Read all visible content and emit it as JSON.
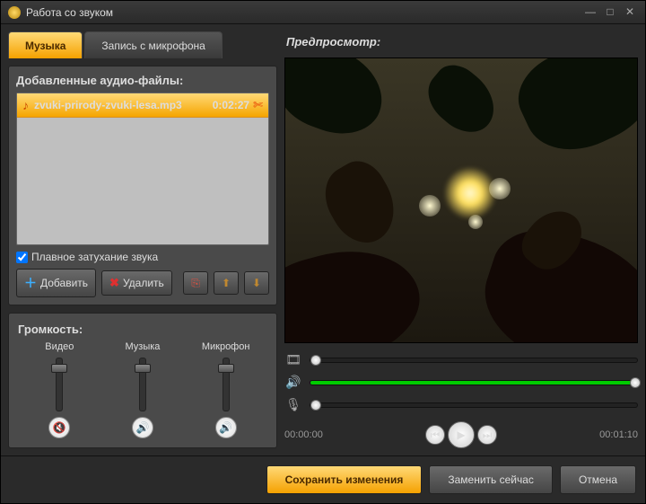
{
  "window": {
    "title": "Работа со звуком"
  },
  "tabs": {
    "music": "Музыка",
    "mic": "Запись с микрофона"
  },
  "files": {
    "heading": "Добавленные аудио-файлы:",
    "list": [
      {
        "name": "zvuki-prirody-zvuki-lesa.mp3",
        "duration": "0:02:27"
      }
    ],
    "fade_label": "Плавное затухание звука",
    "fade_checked": true,
    "add": "Добавить",
    "delete": "Удалить"
  },
  "volume": {
    "heading": "Громкость:",
    "video": "Видео",
    "music": "Музыка",
    "mic": "Микрофон"
  },
  "preview": {
    "heading": "Предпросмотр:"
  },
  "playback": {
    "current": "00:00:00",
    "total": "00:01:10"
  },
  "footer": {
    "save": "Сохранить изменения",
    "replace": "Заменить сейчас",
    "cancel": "Отмена"
  }
}
